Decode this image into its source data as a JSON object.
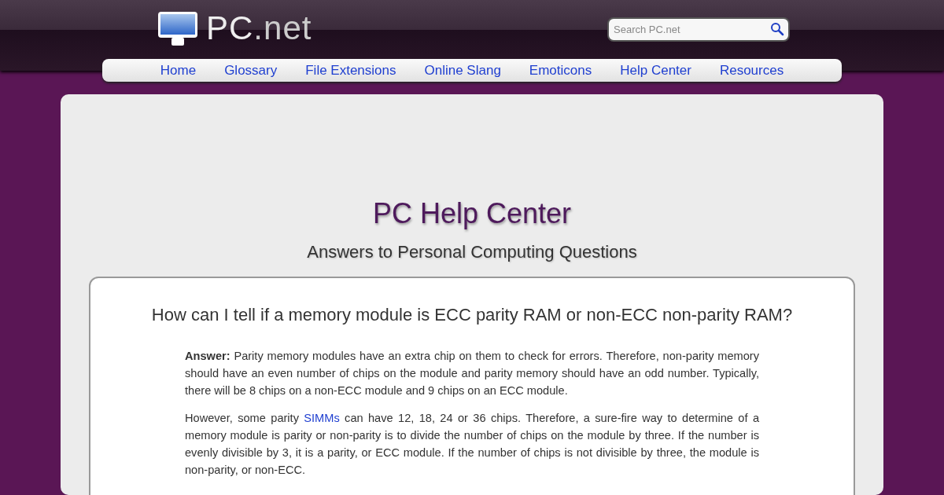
{
  "header": {
    "logo": {
      "name": "PC",
      "suffix": ".net"
    },
    "search": {
      "placeholder": "Search PC.net"
    }
  },
  "nav": [
    {
      "label": "Home"
    },
    {
      "label": "Glossary"
    },
    {
      "label": "File Extensions"
    },
    {
      "label": "Online Slang"
    },
    {
      "label": "Emoticons"
    },
    {
      "label": "Help Center"
    },
    {
      "label": "Resources"
    }
  ],
  "page": {
    "title": "PC Help Center",
    "subtitle": "Answers to Personal Computing Questions"
  },
  "article": {
    "question": "How can I tell if a memory module is ECC parity RAM or non-ECC non-parity RAM?",
    "paragraphs": [
      {
        "text": "**Answer:** Parity memory modules have an extra chip on them to check for errors. Therefore, non-parity memory should have an even number of chips on the module and parity memory should have an odd number. Typically, there will be 8 chips on a non-ECC module and 9 chips on an ECC module."
      },
      {
        "text": "However, some parity ",
        "link": "SIMMs",
        "after": " can have 12, 18, 24 or 36 chips. Therefore, a sure-fire way to determine of a memory module is parity or non-parity is to divide the number of chips on the module by three. If the number is evenly divisible by 3, it is a parity, or ECC module. If the number of chips is not divisible by three, the module is non-parity, or non-ECC."
      }
    ]
  }
}
